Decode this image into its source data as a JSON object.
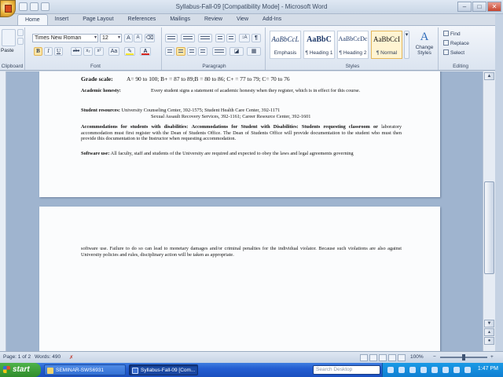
{
  "window": {
    "title": "Syllabus-Fall-09 [Compatibility Mode] - Microsoft Word",
    "controls": {
      "minimize": "–",
      "maximize": "□",
      "close": "✕"
    }
  },
  "ribbon_tabs": [
    "Home",
    "Insert",
    "Page Layout",
    "References",
    "Mailings",
    "Review",
    "View",
    "Add-Ins"
  ],
  "ribbon": {
    "clipboard": {
      "paste_label": "Paste",
      "group_label": "Clipboard"
    },
    "font": {
      "font_name": "Times New Roman",
      "font_size": "12",
      "bold": "B",
      "italic": "I",
      "underline": "U",
      "strike": "abe",
      "subscript": "x₂",
      "superscript": "x²",
      "change_case": "Aa",
      "grow": "A",
      "shrink": "A",
      "font_color": "A",
      "group_label": "Font",
      "highlight_color": "#f6e62a",
      "font_color_value": "#d7261e"
    },
    "paragraph": {
      "group_label": "Paragraph",
      "sort": "↕A",
      "pilcrow": "¶"
    },
    "styles": {
      "items": [
        {
          "sample": "AaBbCcL",
          "name": "Emphasis"
        },
        {
          "sample": "AaBbC",
          "name": "¶ Heading 1"
        },
        {
          "sample": "AaBbCcDc",
          "name": "¶ Heading 2"
        },
        {
          "sample": "AaBbCcI",
          "name": "¶ Normal"
        }
      ],
      "change_styles": "Change Styles",
      "group_label": "Styles"
    },
    "editing": {
      "find": "Find",
      "replace": "Replace",
      "select": "Select",
      "group_label": "Editing"
    }
  },
  "document": {
    "grade_scale": {
      "label": "Grade scale:",
      "text": "A= 90 to 100; B+ = 87 to 89;B   = 80 to 86; C+   = 77 to 79; C= 70 to 76"
    },
    "honesty": {
      "label": "Academic honesty:",
      "text": "Every student signs a statement of academic honesty when they register, which is in effect for this course."
    },
    "resources": {
      "label": "Student resources:",
      "line1": "University Counseling Center, 392-1575; Student Health Care Center, 392-1171",
      "line2": "Sexual Assault Recovery Services, 392-1161; Career Resource Center, 392-1601"
    },
    "accommodations": {
      "label": "Accommodations for students with disabilities:",
      "bold_part": "Accommodations for Student with Disabilities: Students requesting classroom or",
      "text": "laboratory accommodation must first register with the Dean of Students Office. The Dean of Students Office will provide documentation to the student who must then provide this documentation to the Instructor when requesting accommodation."
    },
    "software": {
      "label": "Software use:",
      "text": "All faculty, staff and students of the University are required and expected to obey the laws and legal agreements governing"
    },
    "page2_text": "software use.  Failure to do so can lead to monetary damages and/or criminal penalties for the individual violator.  Because such violations are also against University policies and rules, disciplinary action will be taken as appropriate."
  },
  "statusbar": {
    "page": "Page: 1 of 2",
    "words": "Words: 490",
    "zoom": "100%"
  },
  "taskbar": {
    "start": "start",
    "task1": "SEMINAR-SWS6931",
    "task2": "Syllabus-Fall-09 [Com...",
    "search_placeholder": "Search Desktop",
    "clock": "1:47 PM"
  }
}
